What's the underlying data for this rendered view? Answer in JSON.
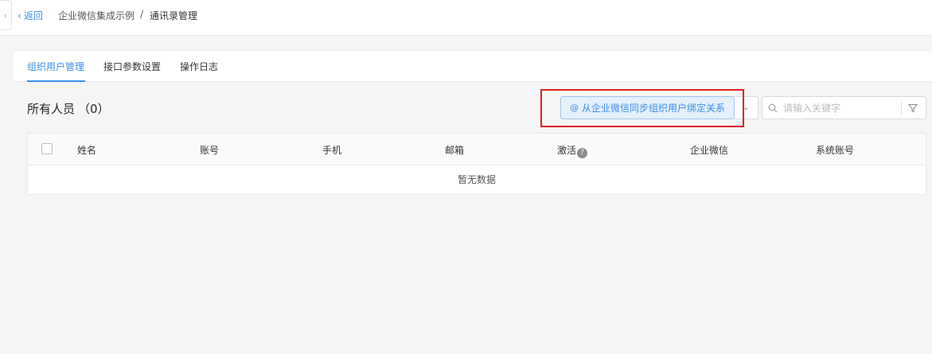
{
  "nav": {
    "back_label": "返回",
    "breadcrumb": [
      "企业微信集成示例",
      "通讯录管理"
    ],
    "separator": "/"
  },
  "tabs": [
    {
      "label": "组织用户管理",
      "active": true
    },
    {
      "label": "接口参数设置",
      "active": false
    },
    {
      "label": "操作日志",
      "active": false
    }
  ],
  "heading": {
    "title": "所有人员",
    "count": "（0）"
  },
  "toolbar": {
    "sync_icon": "@",
    "sync_label": "从企业微信同步组织用户绑定关系",
    "search_placeholder": "请输入关键字"
  },
  "table": {
    "columns": [
      "姓名",
      "账号",
      "手机",
      "邮箱",
      "激活",
      "企业微信",
      "系统账号"
    ],
    "help_icon_glyph": "?",
    "empty_text": "暂无数据"
  },
  "colors": {
    "accent": "#3a8ee6",
    "highlight": "#e0191f",
    "background": "#f5f5f5"
  }
}
